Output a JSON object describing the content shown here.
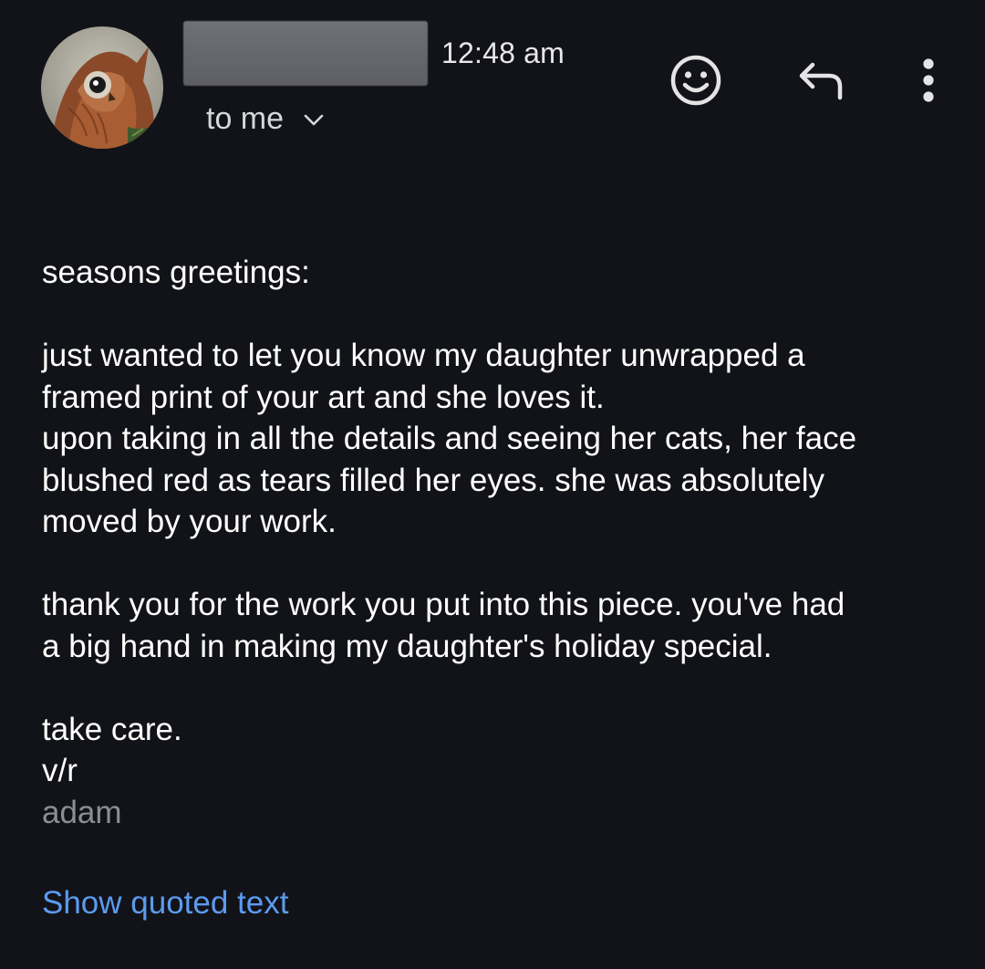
{
  "header": {
    "time": "12:48 am",
    "recipient_label": "to me",
    "icons": {
      "avatar": "owl-avatar",
      "recipient_toggle": "chevron-down-icon",
      "react": "emoji-smile-icon",
      "reply": "reply-icon",
      "more": "more-vert-icon"
    }
  },
  "message": {
    "greeting": "seasons greetings:",
    "paragraph1": [
      "just wanted to let you know my daughter unwrapped a",
      "framed print of your art and she loves it.",
      "upon taking in all the details and seeing her cats, her face",
      "blushed red as tears filled her eyes.  she was absolutely",
      "moved by your work."
    ],
    "paragraph2": [
      "thank you for the work you put into this piece.  you've had",
      "a big hand in making my daughter's holiday special."
    ],
    "closing": "take care.",
    "signoff": "v/r",
    "signature": "adam"
  },
  "footer": {
    "show_quoted_label": "Show quoted text"
  },
  "colors": {
    "background": "#121318",
    "text": "#ffffff",
    "muted": "#8d8e92",
    "link": "#5b9bf0",
    "redaction": "#66686d"
  }
}
